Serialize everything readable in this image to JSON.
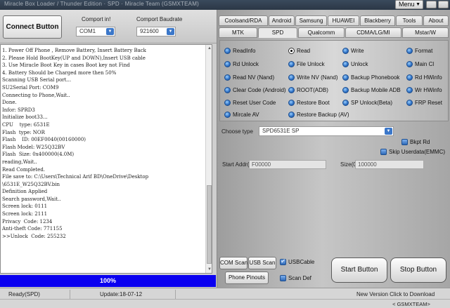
{
  "window": {
    "title": "Miracle Box Loader / Thunder Edition · SPD · Miracle Team (GSMXTEAM)",
    "menu_label": "Menu",
    "min_glyph": "‒",
    "close_glyph": "✕"
  },
  "connection": {
    "connect_label": "Connect Button",
    "comport_label": "Comport in!",
    "comport_value": "COM1",
    "baud_label": "Comport Baudrate",
    "baud_value": "921600"
  },
  "log_lines": [
    "1. Power Off Phone , Remove Battery, Insert Battery Back",
    "2. Please Hold BootKey(UP and DOWN),Insert USB cable",
    "3. Use Miracle Boot Key in cases Boot key not Find",
    "4. Battery Should be Charged more then 50%",
    "Scanning USB Serial port...",
    "SU2Serial Port: COM9",
    "Connecting to Phone,Wait..",
    "Done.",
    "Infor: SPRD3",
    "Initialize boot33...",
    "CPU    type: 6531E",
    "Flash  type: NOR",
    "Flash    ID: 00EF0040(00160000)",
    "Flash Model: W25Q32BV",
    "Flash  Size: 0x400000(4.0M)",
    "reading,Wait..",
    "Read Completed.",
    "File save to: C:\\Users\\Technical Arif BD\\OneDrive\\Desktop",
    "\\6531E_W25Q32BV.bin",
    "Definition Applied",
    "Search password,Wait..",
    "Screen lock: 0111",
    "Screen lock: 2111",
    "Privacy  Code: 1234",
    "Anti-theft Code: 771155",
    ">>Unlock  Code: 255232"
  ],
  "progress": {
    "label": "100%",
    "value": 1.0
  },
  "tabs_row1": [
    "Coolsand/RDA",
    "Android",
    "Samsung",
    "HUAWEI",
    "Blackberry",
    "Tools",
    "About"
  ],
  "tabs_row2": [
    "MTK",
    "SPD",
    "Qualcomm",
    "CDMA/LG/MI",
    "Mstar/W"
  ],
  "active_tab": "SPD",
  "options": [
    {
      "label": "ReadInfo",
      "on": false
    },
    {
      "label": "Read",
      "on": true
    },
    {
      "label": "Write",
      "on": false
    },
    {
      "label": "Format",
      "on": false
    },
    {
      "label": "Rd Unlock",
      "on": false
    },
    {
      "label": "File Unlock",
      "on": false
    },
    {
      "label": "Unlock",
      "on": false
    },
    {
      "label": "Main Cl",
      "on": false
    },
    {
      "label": "Read NV (Nand)",
      "on": false
    },
    {
      "label": "Write NV (Nand)",
      "on": false
    },
    {
      "label": "Backup Phonebook",
      "on": false
    },
    {
      "label": "Rd HWinfo",
      "on": false
    },
    {
      "label": "Clear Code (Android)",
      "on": false
    },
    {
      "label": "ROOT(ADB)",
      "on": false
    },
    {
      "label": "Backup Mobile ADB",
      "on": false
    },
    {
      "label": "Wr HWinfo",
      "on": false
    },
    {
      "label": "Reset User Code",
      "on": false
    },
    {
      "label": "Restore Boot",
      "on": false
    },
    {
      "label": "SP Unlock(Beta)",
      "on": false
    },
    {
      "label": "FRP Reset",
      "on": false
    },
    {
      "label": "Mircale AV",
      "on": false
    },
    {
      "label": "Restore Backup (AV)",
      "on": false
    }
  ],
  "settings": {
    "choose_type_label": "Choose type",
    "choose_type_value": "SPD6531E SP",
    "bkpt_label": "Bkpt Rd",
    "skip_label": "Skip Userdata(EMMC)",
    "start_label": "Start Addr(",
    "start_value": "F00000",
    "size_label": "Size(0",
    "size_value": "100000"
  },
  "bottom": {
    "com_scan": "COM Scan",
    "usb_scan": "USB Scan",
    "usbcable_label": "USBCable",
    "phone_pinouts": "Phone Pinouts",
    "scan_def": "Scan Def",
    "start_button": "Start Button",
    "stop_button": "Stop Button"
  },
  "status": {
    "ready": "Ready(SPD)",
    "update": "Update:18-07-12",
    "new_version": "New Version Click to Download",
    "team": "< GSMXTEAM>"
  }
}
